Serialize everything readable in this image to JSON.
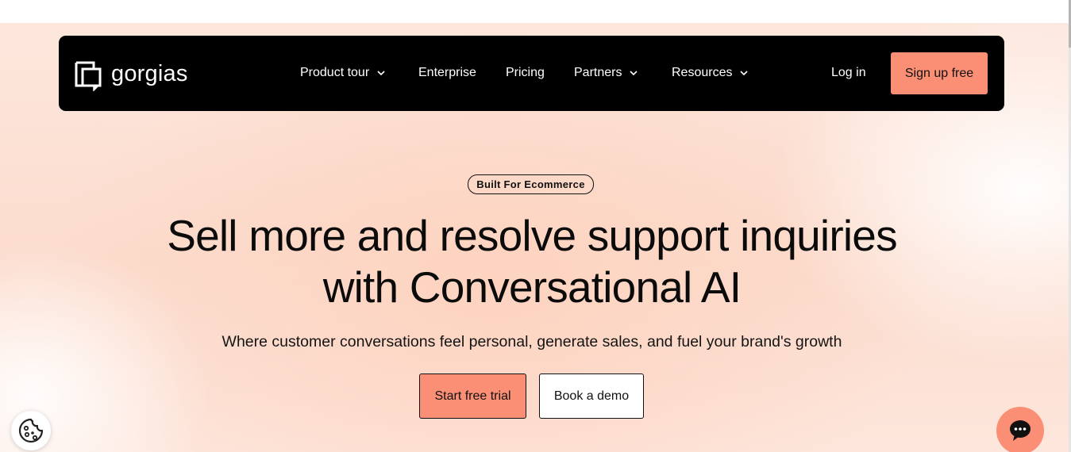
{
  "colors": {
    "accent": "#fb8f75",
    "nav_background": "#000000",
    "hero_background": "#fcdccd",
    "text": "#111111"
  },
  "nav": {
    "logo_text": "gorgias",
    "logo_icon": "gorgias-logo-icon",
    "items": [
      {
        "label": "Product tour",
        "has_dropdown": true
      },
      {
        "label": "Enterprise",
        "has_dropdown": false
      },
      {
        "label": "Pricing",
        "has_dropdown": false
      },
      {
        "label": "Partners",
        "has_dropdown": true
      },
      {
        "label": "Resources",
        "has_dropdown": true
      }
    ],
    "login_label": "Log in",
    "signup_label": "Sign up free"
  },
  "hero": {
    "badge": "Built For Ecommerce",
    "headline_line1": "Sell more and resolve support inquiries",
    "headline_line2": "with Conversational AI",
    "subheadline": "Where customer conversations feel personal, generate sales, and fuel your brand's growth",
    "primary_cta": "Start free trial",
    "secondary_cta": "Book a demo"
  },
  "widgets": {
    "cookie_icon": "cookie-icon",
    "chat_icon": "chat-bubble-icon"
  }
}
